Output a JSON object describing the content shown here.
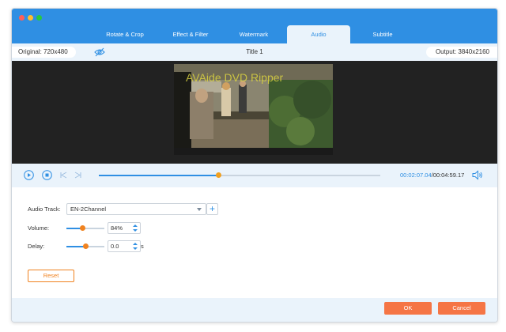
{
  "window": {
    "traffic_lights": [
      "close",
      "minimize",
      "zoom"
    ]
  },
  "tabs": [
    {
      "label": "Rotate & Crop",
      "active": false
    },
    {
      "label": "Effect & Filter",
      "active": false
    },
    {
      "label": "Watermark",
      "active": false
    },
    {
      "label": "Audio",
      "active": true
    },
    {
      "label": "Subtitle",
      "active": false
    }
  ],
  "info": {
    "original": "Original: 720x480",
    "title": "Title 1",
    "output": "Output: 3840x2160",
    "preview_icon": "eye-slash-icon"
  },
  "preview": {
    "watermark_text": "AVAide DVD Ripper"
  },
  "player": {
    "current_time": "00:02:07.04",
    "total_time": "/00:04:59.17",
    "progress": 0.425,
    "icons": [
      "play-icon",
      "stop-icon",
      "previous-frame-icon",
      "next-frame-icon",
      "speaker-icon"
    ]
  },
  "audio": {
    "track_label": "Audio Track:",
    "track_value": "EN-2Channel",
    "add_icon": "plus-icon",
    "volume_label": "Volume:",
    "volume_value": "84%",
    "volume_level": 0.42,
    "delay_label": "Delay:",
    "delay_value": "0.0",
    "delay_unit": "s",
    "delay_level": 0.5,
    "reset_label": "Reset"
  },
  "footer": {
    "ok_label": "OK",
    "cancel_label": "Cancel"
  },
  "colors": {
    "titlebar": "#2f8fe3",
    "accent": "#2f8fe3",
    "button_orange": "#f57545",
    "knob_orange": "#f0821f",
    "panel_bg": "#eaf3fb"
  }
}
